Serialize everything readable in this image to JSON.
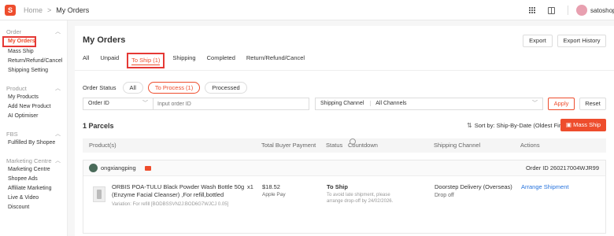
{
  "topbar": {
    "logo": "S",
    "crumb_home": "Home",
    "crumb_sep": ">",
    "crumb_current": "My Orders",
    "username": "satoshop"
  },
  "sidebar": {
    "sections": [
      {
        "title": "Order",
        "items": [
          "My Orders",
          "Mass Ship",
          "Return/Refund/Cancel",
          "Shipping Setting"
        ]
      },
      {
        "title": "Product",
        "items": [
          "My Products",
          "Add New Product",
          "AI Optimiser"
        ]
      },
      {
        "title": "FBS",
        "items": [
          "Fulfilled By Shopee"
        ]
      },
      {
        "title": "Marketing Centre",
        "items": [
          "Marketing Centre",
          "Shopee Ads",
          "Affiliate Marketing",
          "Live & Video",
          "Discount"
        ]
      }
    ]
  },
  "main": {
    "title": "My Orders",
    "export_label": "Export",
    "export_history_label": "Export History",
    "tabs": [
      "All",
      "Unpaid",
      "To Ship (1)",
      "Shipping",
      "Completed",
      "Return/Refund/Cancel"
    ],
    "order_status_label": "Order Status",
    "status_pills": [
      "All",
      "To Process (1)",
      "Processed"
    ],
    "filter": {
      "search_type": "Order ID",
      "search_placeholder": "Input order ID",
      "shipping_channel_label": "Shipping Channel",
      "shipping_channel_value": "All Channels",
      "apply_label": "Apply",
      "reset_label": "Reset"
    },
    "parcels_title": "1 Parcels",
    "sort_label": "Sort by: Ship-By-Date (Oldest First)",
    "mass_ship_label": "Mass Ship",
    "columns": [
      "Product(s)",
      "Total Buyer Payment",
      "Status",
      "Countdown",
      "Shipping Channel",
      "Actions"
    ]
  },
  "order": {
    "buyer": "ongxiangping",
    "order_id": "Order ID 260217004WJR99",
    "product_name": "ORBIS POA-TULU Black Powder Wash Bottle 50g (Enzyme Facial Cleanser) ,For refill,bottled",
    "quantity": "x1",
    "variation": "Variation: For refill [BODBSSVN2J:BOD6G7WJCJ 0.05]",
    "price": "$18.52",
    "payment": "Apple Pay",
    "status": "To Ship",
    "status_note": "To avoid late shipment, please arrange drop-off by 24/02/2026.",
    "shipping_channel": "Doorstep Delivery (Overseas)",
    "shipping_sub": "Drop off",
    "action": "Arrange Shipment"
  },
  "colors": {
    "accent": "#ee4d2d",
    "link": "#2673dd",
    "highlight_box": "#e53935"
  }
}
